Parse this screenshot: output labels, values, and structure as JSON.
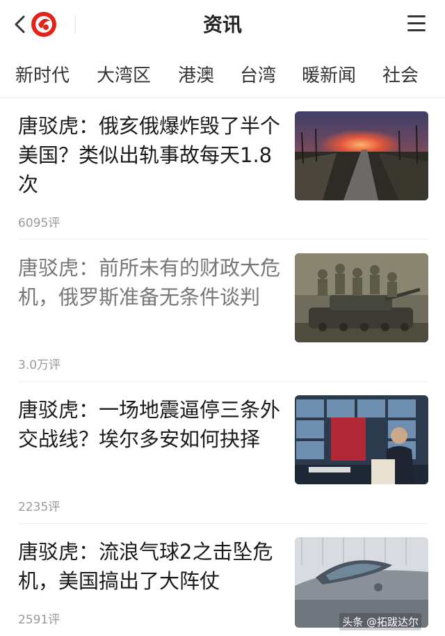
{
  "header": {
    "title": "资讯",
    "back_icon": "chevron-left-icon",
    "logo_icon": "phoenix-logo-icon",
    "menu_icon": "hamburger-menu-icon",
    "accent": "#e2231a"
  },
  "tabs": [
    {
      "label": "新时代"
    },
    {
      "label": "大湾区"
    },
    {
      "label": "港澳"
    },
    {
      "label": "台湾"
    },
    {
      "label": "暖新闻"
    },
    {
      "label": "社会"
    }
  ],
  "articles": [
    {
      "title": "唐驳虎：俄亥俄爆炸毁了半个美国？类似出轨事故每天1.8次",
      "comments": "6095评",
      "read": false,
      "thumb": "train-derailment-fire-photo"
    },
    {
      "title": "唐驳虎：前所未有的财政大危机，俄罗斯准备无条件谈判",
      "comments": "3.0万评",
      "read": true,
      "thumb": "soldiers-on-tank-photo"
    },
    {
      "title": "唐驳虎：一场地震逼停三条外交战线？埃尔多安如何抉择",
      "comments": "2235评",
      "read": false,
      "thumb": "erdogan-press-conference-photo"
    },
    {
      "title": "唐驳虎：流浪气球2之击坠危机，美国搞出了大阵仗",
      "comments": "2591评",
      "read": false,
      "thumb": "fighter-jet-cockpit-photo"
    }
  ],
  "watermark": "头条 @拓跋达尔"
}
